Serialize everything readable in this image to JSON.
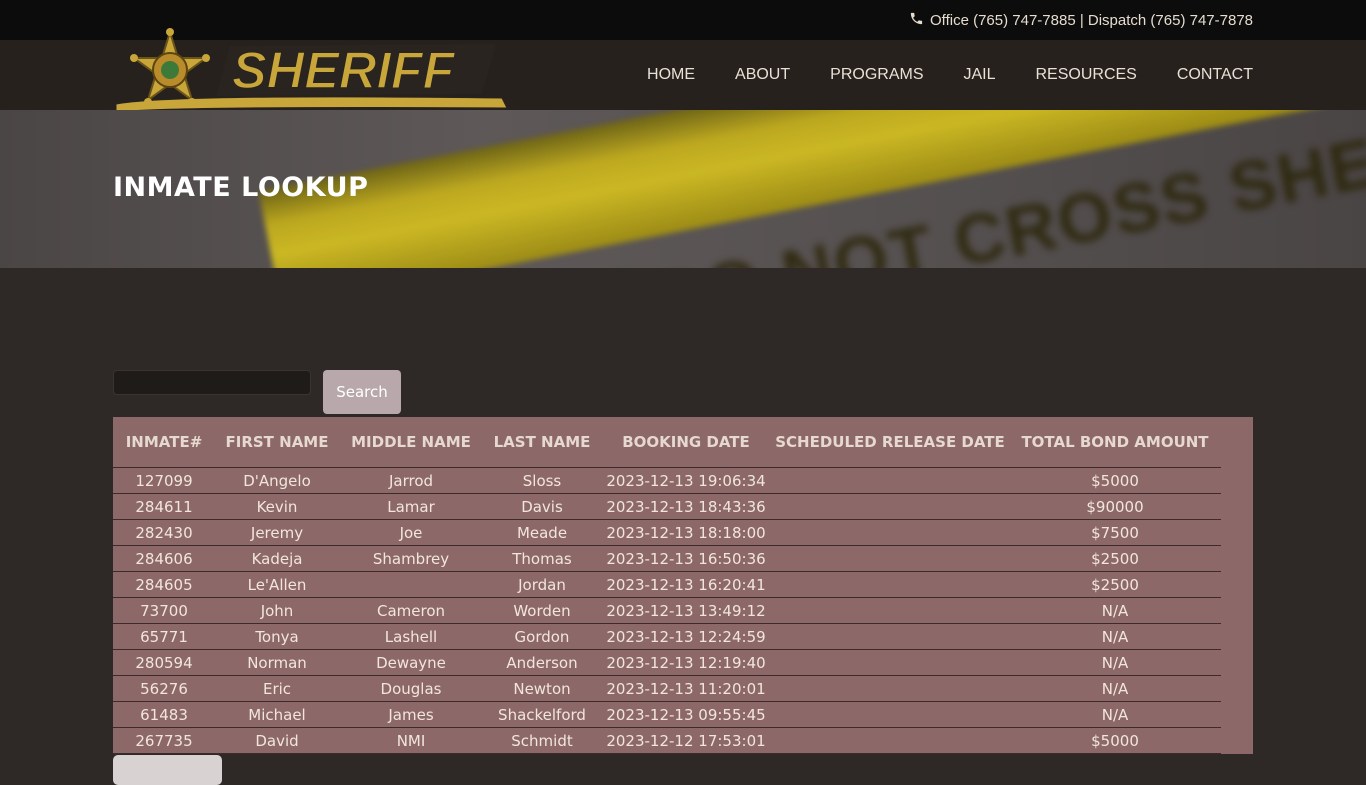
{
  "topbar": {
    "contact_text": "Office (765) 747-7885 | Dispatch (765) 747-7878",
    "icon": "phone-icon"
  },
  "logo": {
    "wordmark": "SHERIFF",
    "colors": {
      "gold": "#c9a63a",
      "dark": "#2a2420"
    }
  },
  "nav": {
    "items": [
      {
        "label": "HOME"
      },
      {
        "label": "ABOUT"
      },
      {
        "label": "PROGRAMS"
      },
      {
        "label": "JAIL"
      },
      {
        "label": "RESOURCES"
      },
      {
        "label": "CONTACT"
      }
    ]
  },
  "banner": {
    "title": "INMATE LOOKUP",
    "tape_text": "LINE DO NOT CROSS  SHERIFF LINE D"
  },
  "search": {
    "value": "",
    "placeholder": "",
    "button_label": "Search"
  },
  "table": {
    "columns": [
      "INMATE#",
      "FIRST NAME",
      "MIDDLE NAME",
      "LAST NAME",
      "BOOKING DATE",
      "SCHEDULED RELEASE DATE",
      "TOTAL BOND AMOUNT"
    ],
    "rows": [
      [
        "127099",
        "D'Angelo",
        "Jarrod",
        "Sloss",
        "2023-12-13 19:06:34",
        "",
        "$5000"
      ],
      [
        "284611",
        "Kevin",
        "Lamar",
        "Davis",
        "2023-12-13 18:43:36",
        "",
        "$90000"
      ],
      [
        "282430",
        "Jeremy",
        "Joe",
        "Meade",
        "2023-12-13 18:18:00",
        "",
        "$7500"
      ],
      [
        "284606",
        "Kadeja",
        "Shambrey",
        "Thomas",
        "2023-12-13 16:50:36",
        "",
        "$2500"
      ],
      [
        "284605",
        "Le'Allen",
        "",
        "Jordan",
        "2023-12-13 16:20:41",
        "",
        "$2500"
      ],
      [
        "73700",
        "John",
        "Cameron",
        "Worden",
        "2023-12-13 13:49:12",
        "",
        "N/A"
      ],
      [
        "65771",
        "Tonya",
        "Lashell",
        "Gordon",
        "2023-12-13 12:24:59",
        "",
        "N/A"
      ],
      [
        "280594",
        "Norman",
        "Dewayne",
        "Anderson",
        "2023-12-13 12:19:40",
        "",
        "N/A"
      ],
      [
        "56276",
        "Eric",
        "Douglas",
        "Newton",
        "2023-12-13 11:20:01",
        "",
        "N/A"
      ],
      [
        "61483",
        "Michael",
        "James",
        "Shackelford",
        "2023-12-13 09:55:45",
        "",
        "N/A"
      ],
      [
        "267735",
        "David",
        "NMI",
        "Schmidt",
        "2023-12-12 17:53:01",
        "",
        "$5000"
      ]
    ]
  },
  "colors": {
    "page_bg": "#2e2926",
    "table_bg": "#8d6868",
    "button_bg": "#b9a8ab",
    "topbar_bg": "#0c0c0c"
  }
}
